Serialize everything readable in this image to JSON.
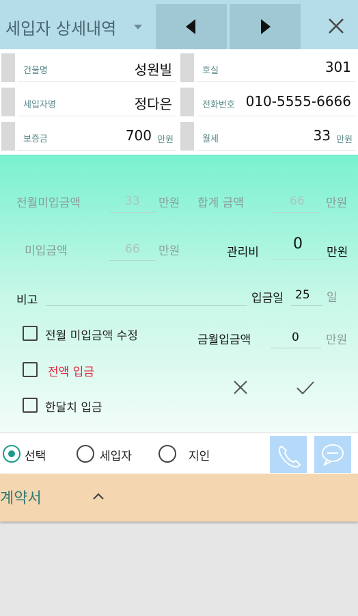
{
  "header": {
    "title": "세입자 상세내역",
    "icons": {
      "dropdown": "caret-down-icon",
      "prev": "prev-triangle-icon",
      "next": "next-triangle-icon",
      "close": "close-icon"
    }
  },
  "info": {
    "building": {
      "label": "건물명",
      "value": "성원빌"
    },
    "room": {
      "label": "호실",
      "value": "301"
    },
    "tenant": {
      "label": "세입자명",
      "value": "정다은"
    },
    "phone": {
      "label": "전화번호",
      "value": "010-5555-6666"
    },
    "deposit": {
      "label": "보증금",
      "value": "700",
      "unit": "만원"
    },
    "rent": {
      "label": "월세",
      "value": "33",
      "unit": "만원"
    }
  },
  "payment": {
    "prev_unpaid": {
      "label": "전월미입금액",
      "value": "33",
      "unit": "만원"
    },
    "total": {
      "label": "합계 금액",
      "value": "66",
      "unit": "만원"
    },
    "unpaid": {
      "label": "미입금액",
      "value": "66",
      "unit": "만원"
    },
    "mgmt_fee": {
      "label": "관리비",
      "value": "0",
      "unit": "만원"
    },
    "note": {
      "label": "비고",
      "value": ""
    },
    "pay_day": {
      "label": "입금일",
      "value": "25",
      "unit": "일"
    },
    "this_month": {
      "label": "금월입금액",
      "value": "0",
      "unit": "만원"
    },
    "checks": [
      {
        "label": "전월 미입금액 수정",
        "checked": false
      },
      {
        "label": "전액 입금",
        "checked": false,
        "color": "#e0233c"
      },
      {
        "label": "한달치 입금",
        "checked": false
      }
    ],
    "icons": {
      "cancel": "close-x-icon",
      "confirm": "checkmark-icon"
    }
  },
  "contact": {
    "options": [
      {
        "label": "선택",
        "selected": true
      },
      {
        "label": "세입자",
        "selected": false
      },
      {
        "label": "지인",
        "selected": false
      }
    ],
    "icons": {
      "call": "phone-icon",
      "message": "message-icon"
    },
    "accent": "#1a9a8a",
    "button_color": "#b5d9f8"
  },
  "contract": {
    "title": "계약서",
    "icon": "chevron-up-icon"
  },
  "colors": {
    "header_bg": "#b4dde9",
    "nav_btn_bg": "#9fc8d4",
    "contract_bg": "#f4d6b1",
    "label_teal": "#5b8a8a"
  }
}
